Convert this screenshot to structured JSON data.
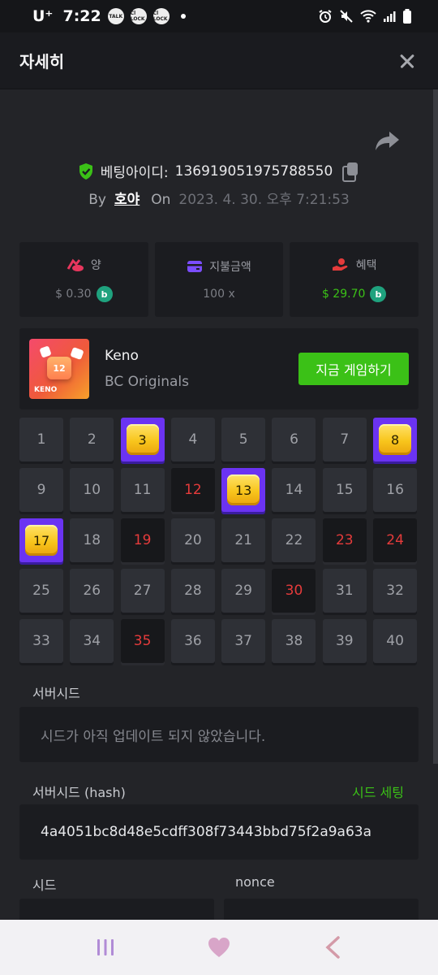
{
  "status_bar": {
    "carrier": "U⁺",
    "time": "7:22",
    "notifications": [
      "TALK",
      "Cl LOCK",
      "Cl LOCK"
    ]
  },
  "header": {
    "title": "자세히"
  },
  "bet": {
    "id_label": "베팅아이디:",
    "id_value": "1369190519757885​50",
    "by_label": "By",
    "username": "호야",
    "on_label": "On",
    "date": "2023. 4. 30. 오후 7:21:53"
  },
  "stats": [
    {
      "label": "양",
      "value": "$ 0.30",
      "icon": "bet-amount-icon",
      "color": "#e8365d"
    },
    {
      "label": "지불금액",
      "value": "100 x",
      "icon": "wallet-icon",
      "color": "#7b4dff"
    },
    {
      "label": "혜택",
      "value": "$ 29.70",
      "icon": "profit-hand-icon",
      "color": "#e53b3b"
    }
  ],
  "game": {
    "name": "Keno",
    "provider": "BC Originals",
    "play_label": "지금 게임하기",
    "thumb_label": "KENO",
    "thumb_number": "12"
  },
  "keno": {
    "numbers": [
      1,
      2,
      3,
      4,
      5,
      6,
      7,
      8,
      9,
      10,
      11,
      12,
      13,
      14,
      15,
      16,
      17,
      18,
      19,
      20,
      21,
      22,
      23,
      24,
      25,
      26,
      27,
      28,
      29,
      30,
      31,
      32,
      33,
      34,
      35,
      36,
      37,
      38,
      39,
      40
    ],
    "hits": [
      3,
      8,
      13,
      17
    ],
    "misses": [
      12,
      19,
      23,
      24,
      30,
      35
    ]
  },
  "seeds": {
    "server_seed_label": "서버시드",
    "server_seed_value": "시드가 아직 업데이트 되지 않았습니다.",
    "server_hash_label": "서버시드 (hash)",
    "seed_settings_label": "시드 세팅",
    "server_hash_value": "4a4051bc8d48e5cdff308f73443bbd75f2a9a63a",
    "client_seed_label": "시드",
    "nonce_label": "nonce"
  },
  "colors": {
    "accent_green": "#3bc117",
    "hit_purple": "#6b33f2",
    "miss_red": "#e53b3b"
  }
}
